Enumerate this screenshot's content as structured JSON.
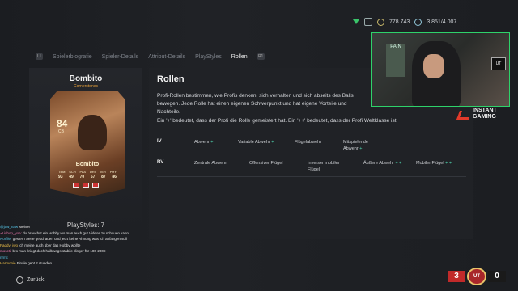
{
  "topbar": {
    "coins": "778.743",
    "points": "3.851/4.007"
  },
  "tabs": [
    {
      "label": "Spielerbiografie",
      "active": false
    },
    {
      "label": "Spieler-Details",
      "active": false
    },
    {
      "label": "Attribut-Details",
      "active": false
    },
    {
      "label": "PlayStyles",
      "active": false
    },
    {
      "label": "Rollen",
      "active": true
    }
  ],
  "tab_keys": {
    "left": "L1",
    "right": "R1"
  },
  "player": {
    "name": "Bombito",
    "subtitle": "Cornerstones",
    "card": {
      "rating": "84",
      "position": "CB",
      "name": "Bombito",
      "stat_labels": [
        "TEM",
        "SCH",
        "PAS",
        "DRI",
        "VER",
        "PHY"
      ],
      "stat_values": [
        "93",
        "49",
        "70",
        "67",
        "87",
        "86"
      ]
    },
    "playstyles_label": "PlayStyles: 7"
  },
  "roles": {
    "title": "Rollen",
    "description": "Profi-Rollen bestimmen, wie Profis denken, sich verhalten und sich abseits des Balls bewegen. Jede Rolle hat einen eigenen Schwerpunkt und hat eigene Vorteile und Nachteile.",
    "legend": "Ein '+' bedeutet, dass der Profi die Rolle gemeistert hat. Ein '++' bedeutet, dass der Profi Weltklasse ist.",
    "rows": [
      {
        "position": "IV",
        "roles": [
          "Abwehr +",
          "Variable Abwehr +",
          "Flügelabwehr",
          "Mitspielende Abwehr +"
        ]
      },
      {
        "position": "RV",
        "roles": [
          "Zentrale Abwehr",
          "Offensiver Flügel",
          "Inverser mobiler Flügel",
          "Äußere Abwehr + +",
          "Mobiler Flügel + +"
        ]
      }
    ]
  },
  "webcam": {
    "poster_text": "PAIN",
    "tag": "UT"
  },
  "brand": {
    "line1": "INSTANT",
    "line2": "GAMING"
  },
  "chat": [
    {
      "user": "@jaw_naw",
      "text": "Meiner",
      "color": "u"
    },
    {
      "user": "~Lisbop_yoe:",
      "text": "du brauchst ein Hobby wo man auch gut Videos zu schauen kann",
      "color": "u2"
    },
    {
      "user": "Norfiler",
      "text": "gestern Serie geschauen und jetzt keine Ahnung was ich anfangen soll",
      "color": "u"
    },
    {
      "user": "Paddy_jwo",
      "text": "ich meine auch über das Hobby wollte",
      "color": "u3"
    },
    {
      "user": "mosetii",
      "text": "bro man kriegt doch halbwegs stabile dinger für 100-200€",
      "color": "u2"
    },
    {
      "user": "nrmc",
      "text": "",
      "color": "u"
    },
    {
      "user": "Harmonie",
      "text": "Finale geht 2 stunden",
      "color": "u3"
    }
  ],
  "footer": {
    "back_label": "Zurück"
  },
  "score": {
    "home": "3",
    "away": "0",
    "badge": "UT"
  }
}
